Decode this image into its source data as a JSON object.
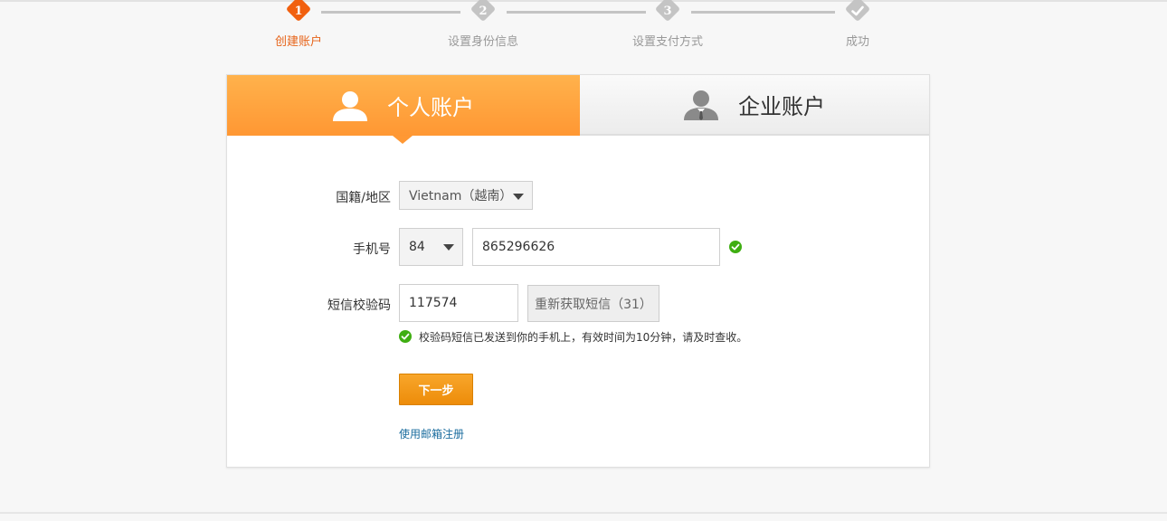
{
  "steps": [
    {
      "number": "1",
      "label": "创建账户",
      "state": "active"
    },
    {
      "number": "2",
      "label": "设置身份信息",
      "state": "pending"
    },
    {
      "number": "3",
      "label": "设置支付方式",
      "state": "pending"
    },
    {
      "number": "",
      "label": "成功",
      "state": "pending",
      "icon": "check-icon"
    }
  ],
  "tabs": {
    "personal": {
      "label": "个人账户",
      "icon": "person-icon"
    },
    "business": {
      "label": "企业账户",
      "icon": "business-person-icon"
    }
  },
  "form": {
    "nationality": {
      "label": "国籍/地区",
      "value": "Vietnam（越南）"
    },
    "phone": {
      "label": "手机号",
      "country_code": "84",
      "number": "865296626"
    },
    "sms": {
      "label": "短信校验码",
      "code": "117574",
      "resend_label": "重新获取短信（31）"
    },
    "hint": "校验码短信已发送到你的手机上，有效时间为10分钟，请及时查收。",
    "next_label": "下一步",
    "email_link": "使用邮箱注册"
  },
  "colors": {
    "accent": "#f1600f",
    "tab_active": "#ff9e3a",
    "success": "#3fae12",
    "link": "#1a6c9e"
  }
}
